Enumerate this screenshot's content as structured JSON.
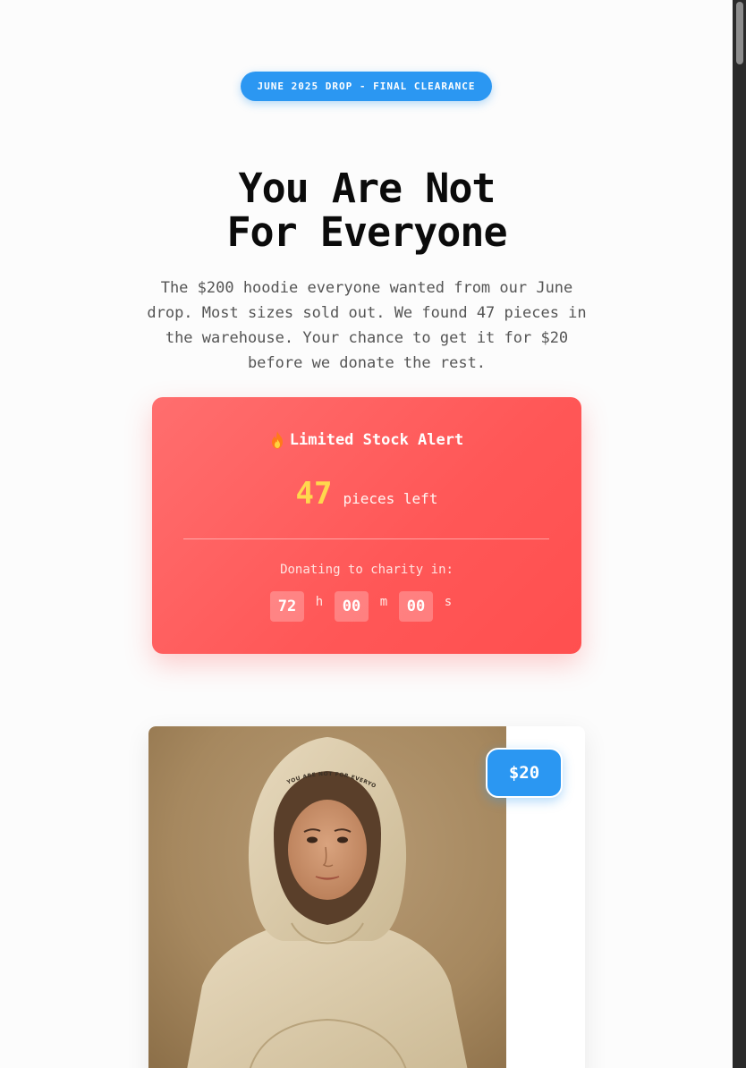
{
  "badge": {
    "label": "JUNE 2025 DROP - FINAL CLEARANCE"
  },
  "hero": {
    "title_line1": "You Are Not",
    "title_line2": "For Everyone",
    "description": "The $200 hoodie everyone wanted from our June drop. Most sizes sold out. We found 47 pieces in the warehouse. Your chance to get it for $20 before we donate the rest."
  },
  "alert": {
    "icon": "fire-icon",
    "title": "Limited Stock Alert",
    "count": "47",
    "count_label": "pieces left",
    "charity_label": "Donating to charity in:",
    "countdown": {
      "hours": "72",
      "hours_unit": "h",
      "minutes": "00",
      "minutes_unit": "m",
      "seconds": "00",
      "seconds_unit": "s"
    }
  },
  "product": {
    "price": "$20",
    "hat_text": "YOU ARE NOT FOR EVERYONE"
  },
  "colors": {
    "accent_blue": "#2b97f2",
    "alert_red": "#ff5757",
    "count_yellow": "#ffd84d"
  }
}
